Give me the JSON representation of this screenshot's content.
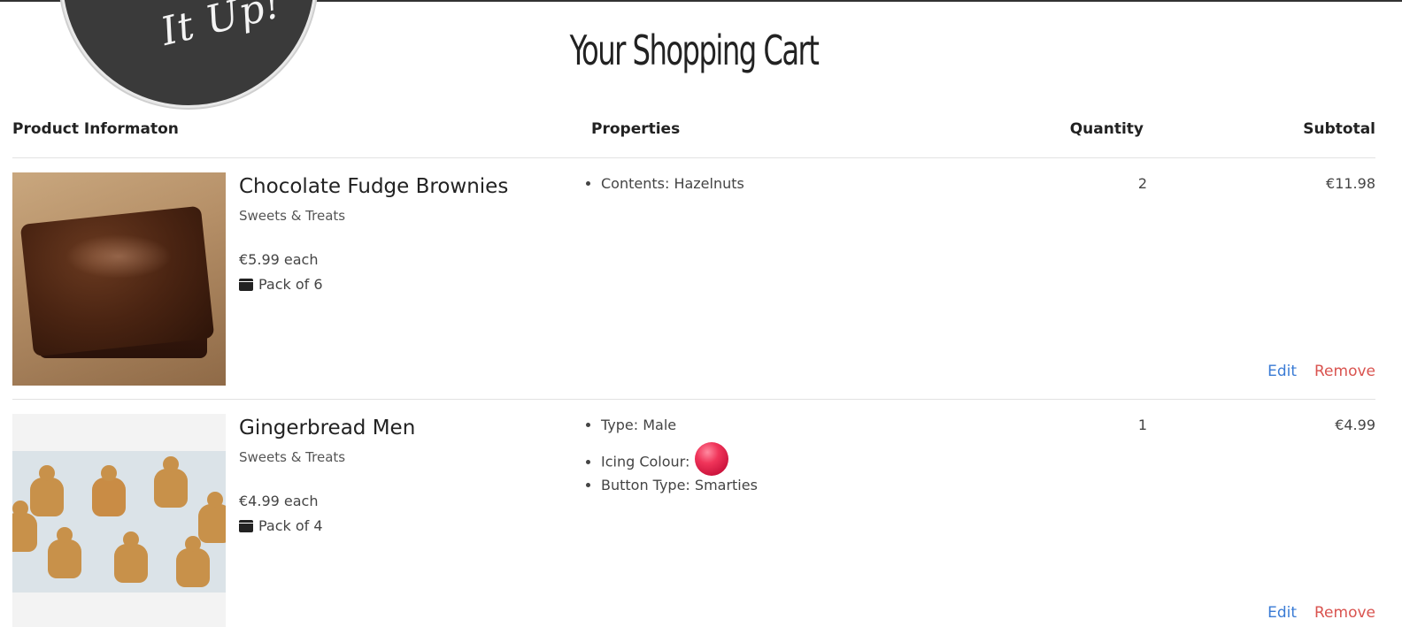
{
  "page": {
    "title": "Your Shopping Cart",
    "logo_text": "It Up!"
  },
  "table": {
    "headers": {
      "info": "Product Informaton",
      "properties": "Properties",
      "quantity": "Quantity",
      "subtotal": "Subtotal"
    }
  },
  "items": [
    {
      "name": "Chocolate Fudge Brownies",
      "category": "Sweets & Treats",
      "price": "€5.99 each",
      "pack": "Pack of 6",
      "properties": [
        {
          "text": "Contents: Hazelnuts"
        }
      ],
      "quantity": "2",
      "subtotal": "€11.98",
      "edit_label": "Edit",
      "remove_label": "Remove"
    },
    {
      "name": "Gingerbread Men",
      "category": "Sweets & Treats",
      "price": "€4.99 each",
      "pack": "Pack of 4",
      "properties": [
        {
          "text": "Type: Male"
        },
        {
          "text": "Icing Colour:",
          "swatch_color": "#e8254a"
        },
        {
          "text": "Button Type: Smarties"
        }
      ],
      "quantity": "1",
      "subtotal": "€4.99",
      "edit_label": "Edit",
      "remove_label": "Remove"
    }
  ],
  "colors": {
    "edit": "#3a7bd5",
    "remove": "#d9534f",
    "text": "#333333"
  },
  "icons": {
    "pack": "box-icon"
  }
}
